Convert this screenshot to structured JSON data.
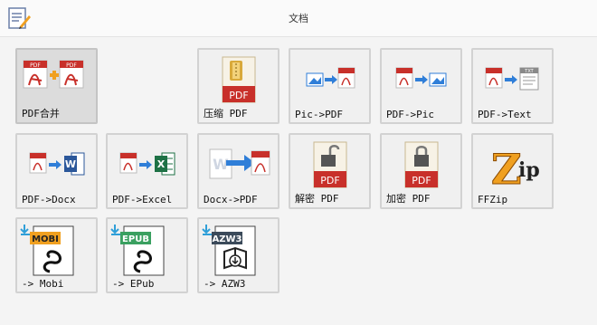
{
  "window": {
    "title": "文档"
  },
  "tiles": [
    {
      "label": "PDF合并"
    },
    {
      "label": "压缩 PDF"
    },
    {
      "label": "Pic->PDF"
    },
    {
      "label": "PDF->Pic"
    },
    {
      "label": "PDF->Text"
    },
    {
      "label": "PDF->Docx"
    },
    {
      "label": "PDF->Excel"
    },
    {
      "label": "Docx->PDF"
    },
    {
      "label": "解密 PDF"
    },
    {
      "label": "加密 PDF"
    },
    {
      "label": "FFZip"
    },
    {
      "label": "-> Mobi"
    },
    {
      "label": "-> EPub"
    },
    {
      "label": "-> AZW3"
    }
  ],
  "icon_text": {
    "pdf": "PDF",
    "txt": "TXT",
    "mobi": "MOBI",
    "epub": "EPUB",
    "azw3": "AZW3"
  },
  "colors": {
    "pdf_red": "#c8302a",
    "word_blue": "#2b579a",
    "excel_green": "#1e7145",
    "arrow_blue": "#2f7ed8",
    "plus_orange": "#f0a020"
  }
}
